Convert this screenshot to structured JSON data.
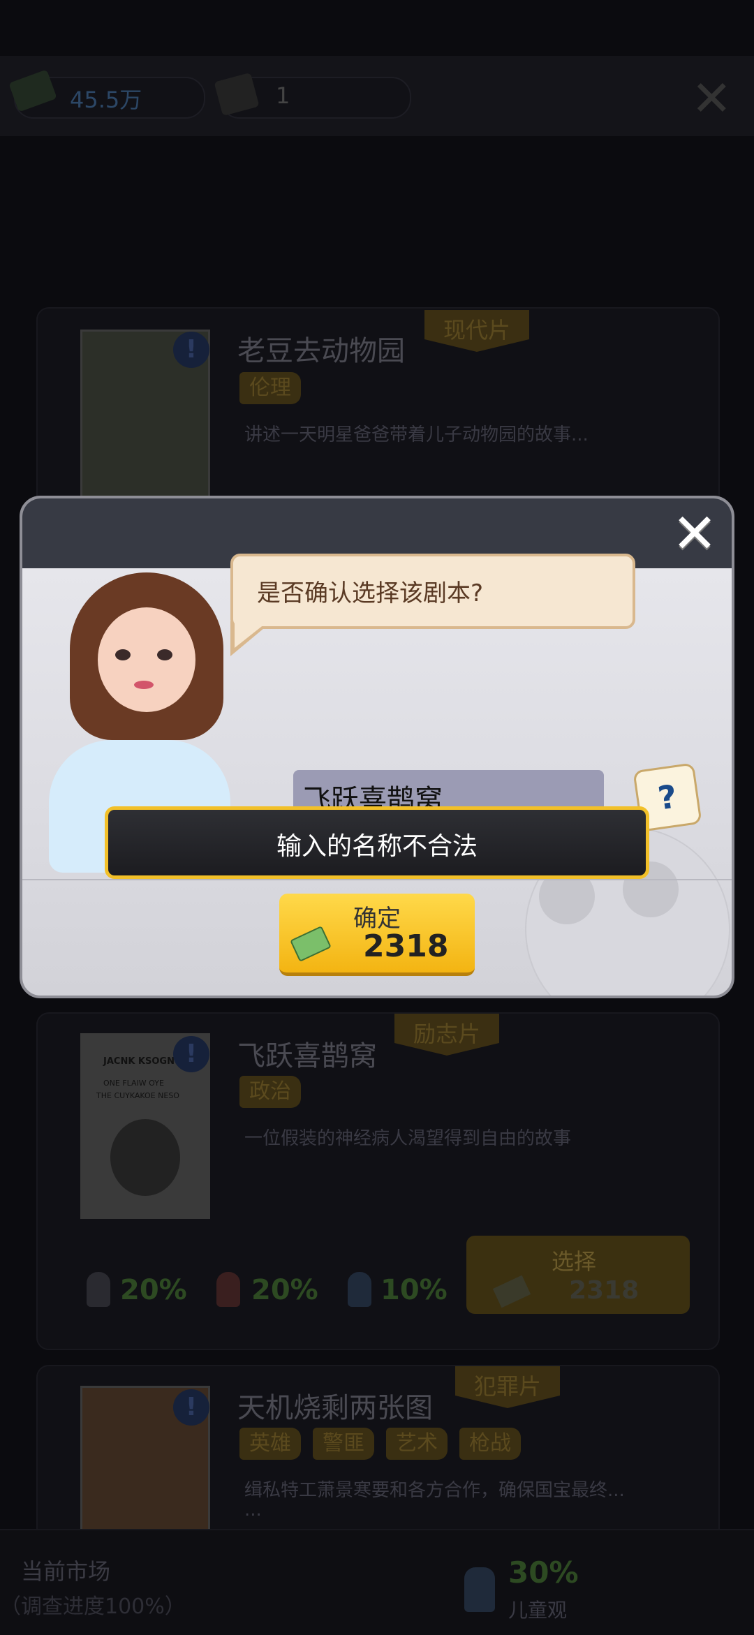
{
  "topbar": {
    "money": "45.5万",
    "scripts": "1"
  },
  "cards": [
    {
      "flag": "现代片",
      "title": "老豆去动物园",
      "tags": [
        "伦理"
      ],
      "desc": "讲述一天明星爸爸带着儿子动物园的故事..."
    },
    {
      "flag": "励志片",
      "title": "飞跃喜鹊窝",
      "tags": [
        "政治"
      ],
      "desc": "一位假装的神经病人渴望得到自由的故事",
      "stats": [
        "20%",
        "20%",
        "10%"
      ],
      "select_label": "选择",
      "select_cost": "2318",
      "poster_text": [
        "JACNK KSOGNOH",
        "ONE FLAIW OYE",
        "THE CUYKAKOE NESO"
      ]
    },
    {
      "flag": "犯罪片",
      "title": "天机烧剩两张图",
      "tags": [
        "英雄",
        "警匪",
        "艺术",
        "枪战"
      ],
      "desc": "缉私特工萧景寒要和各方合作，确保国宝最终...",
      "desc2": "..."
    }
  ],
  "bottom": {
    "market_label": "当前市场",
    "progress": "（调查进度100%）",
    "pct": "30%",
    "audience": "儿童观"
  },
  "dialog": {
    "close": "✕",
    "question": "是否确认选择该剧本?",
    "name_value": "飞跃喜鹊窝",
    "dice_glyph": "?",
    "error": "输入的名称不合法",
    "confirm_label": "确定",
    "confirm_cost": "2318"
  },
  "colors": {
    "accent": "#f2c029",
    "header": "#373a44"
  }
}
